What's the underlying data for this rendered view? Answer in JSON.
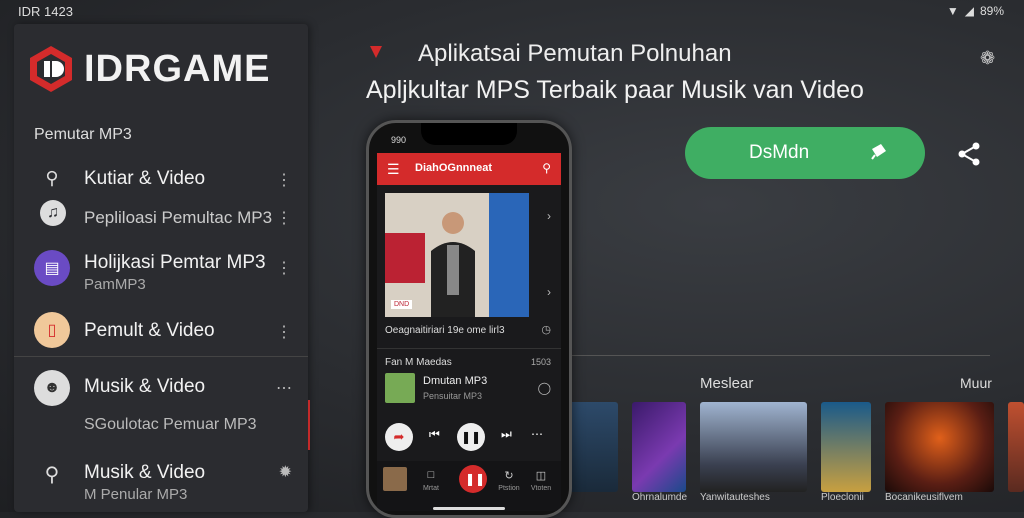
{
  "status": {
    "time": "IDR 1423",
    "battery": "89%"
  },
  "sidebar": {
    "brand": "IDRGAME",
    "heading": "Pemutar MP3",
    "items": [
      {
        "title": "Kutiar & Video",
        "icon": "search-icon"
      },
      {
        "title": "Pepliloasi Pemultac MP3",
        "icon": "music-icon"
      },
      {
        "title": "Holijkasi Pemtar MP3",
        "subtitle": "PamMP3",
        "icon": "document-icon"
      },
      {
        "title": "Pemult & Video",
        "icon": "clipboard-icon"
      },
      {
        "title": "Musik & Video",
        "subtitle": "SGoulotac Pemuar MP3",
        "icon": "avatar"
      },
      {
        "title": "Musik & Video",
        "subtitle": "M Penular MP3",
        "icon": "search-icon"
      }
    ]
  },
  "header": {
    "title1": "Aplikatsai Pemutan Polnuhan",
    "title2": "Apljkultar MPS  Terbaik paar Musik van Video"
  },
  "download": {
    "label": "DsMdn",
    "color": "#3fae63"
  },
  "phone": {
    "status_time": "990",
    "app_title": "DiahOGnnneat",
    "art_badge": "DND",
    "caption": "Oeagnaitiriari 19e ome lirl3",
    "section": "Fan M Maedas",
    "section_right": "1503",
    "track_title": "Dmutan MP3",
    "track_sub": "Pensuitar MP3",
    "nav_labels": [
      "Mrtat",
      "",
      "Ptstion",
      "Vtoten"
    ]
  },
  "section": {
    "title": "Meslear",
    "more": "Muur"
  },
  "thumbnails": [
    {
      "caption": "",
      "color": "#3b5f88"
    },
    {
      "caption": "Ohrnalumde",
      "color": "#5a2d8a"
    },
    {
      "caption": "Yanwitauteshes",
      "color": "#7a8fb0"
    },
    {
      "caption": "Ploeclonii",
      "color": "#2c6a8a"
    },
    {
      "caption": "Bocanikeusiflvem",
      "color": "#5a1e14"
    },
    {
      "caption": "",
      "color": "#8a3a2a"
    }
  ],
  "colors": {
    "accent": "#d42b2b",
    "sidebar": "#2b2c30"
  }
}
